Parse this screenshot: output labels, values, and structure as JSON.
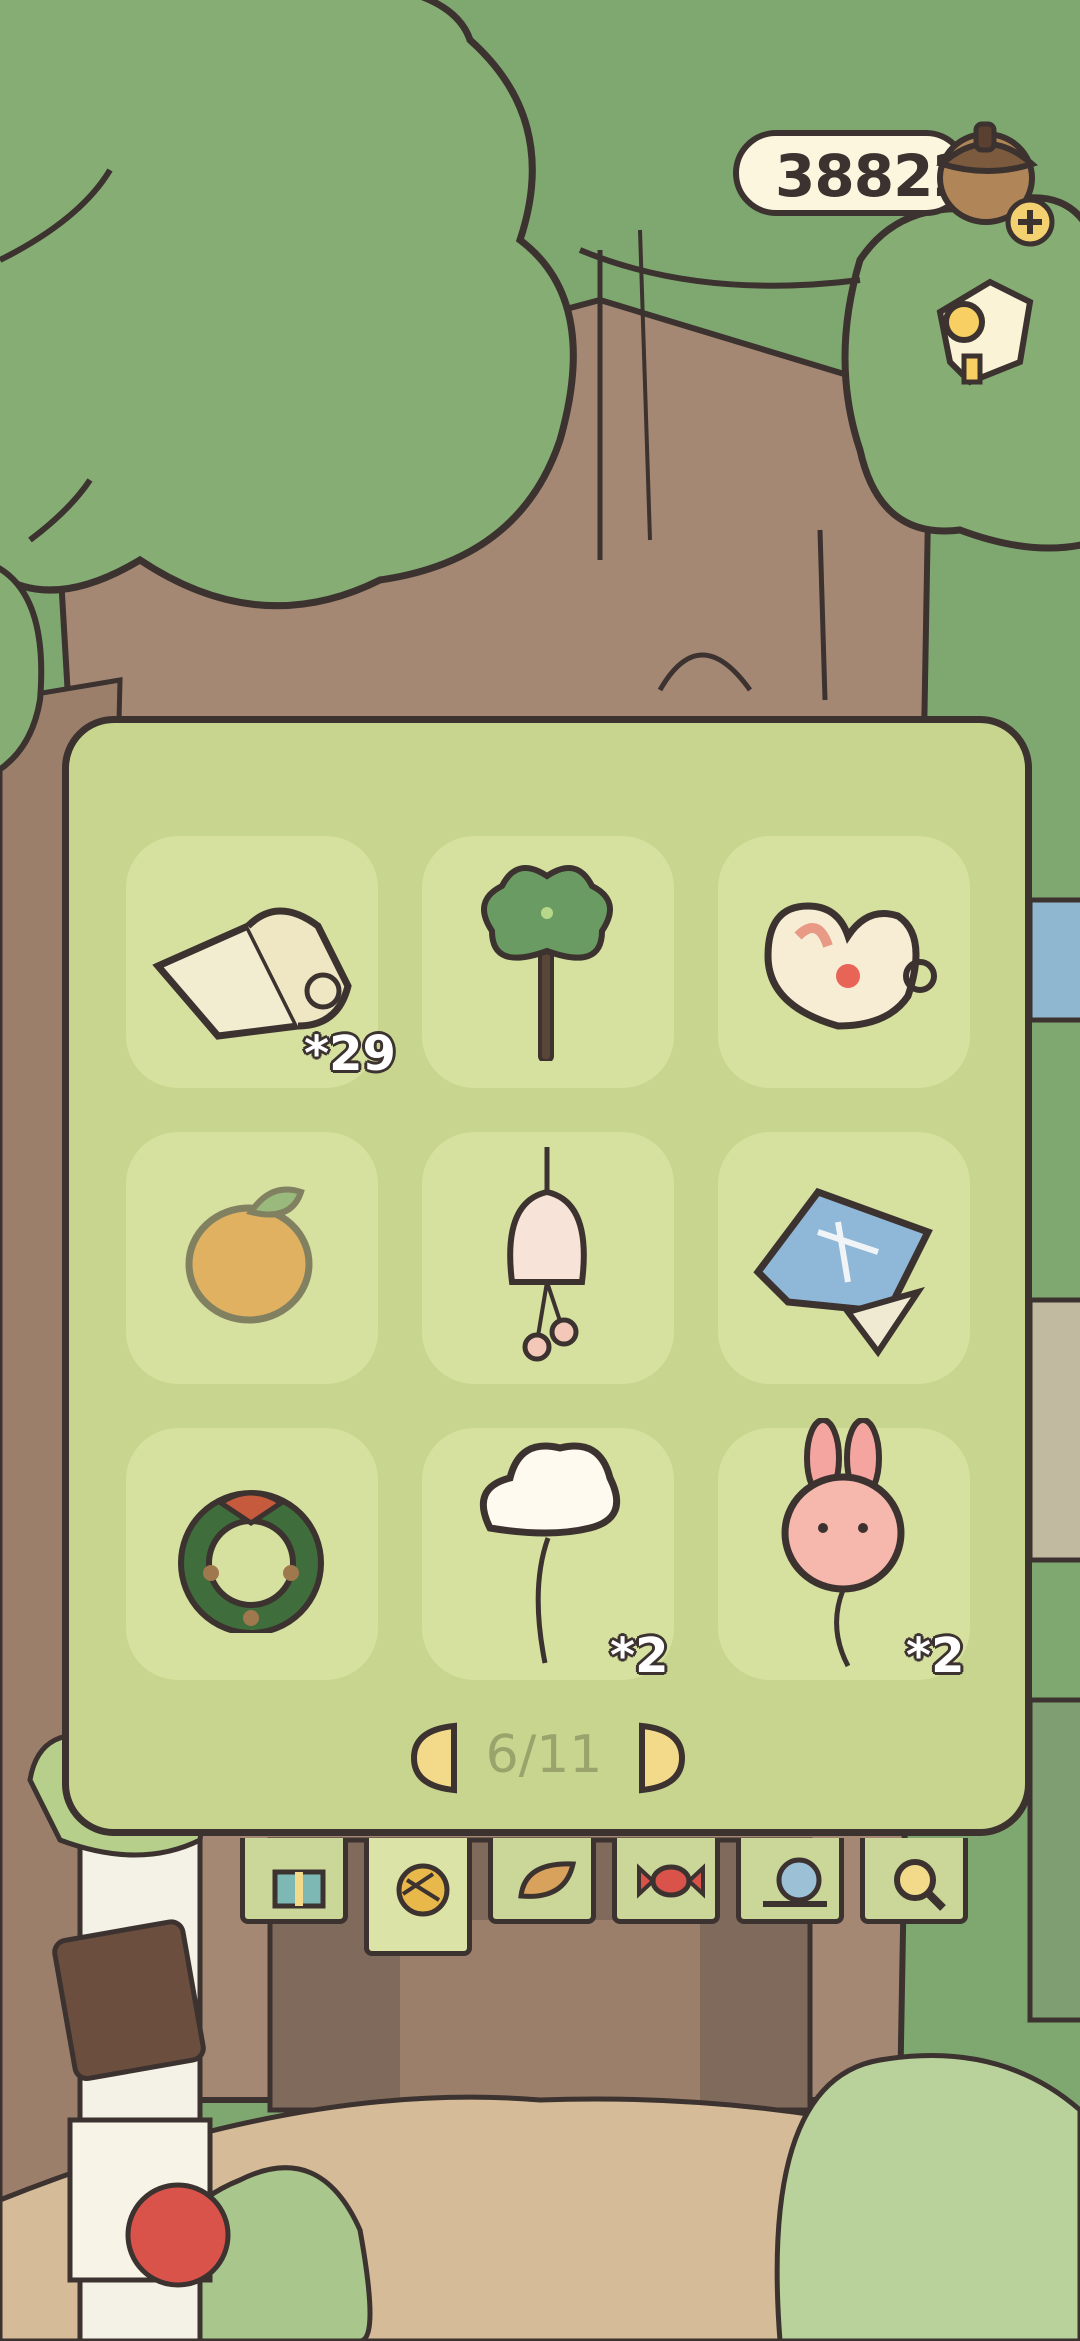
{
  "header": {
    "currency_value": "38822",
    "currency_icon": "acorn-icon",
    "add_icon": "plus-icon",
    "quest_icon": "scroll-icon"
  },
  "panel": {
    "items": [
      {
        "name": "paper-scroll",
        "qty": "*29"
      },
      {
        "name": "clover-stick",
        "qty": ""
      },
      {
        "name": "heart-cup",
        "qty": ""
      },
      {
        "name": "orange-locked",
        "qty": ""
      },
      {
        "name": "wind-chime",
        "qty": ""
      },
      {
        "name": "blueprint-map",
        "qty": ""
      },
      {
        "name": "holiday-wreath",
        "qty": ""
      },
      {
        "name": "cloud-balloon",
        "qty": "*2"
      },
      {
        "name": "bunny-balloon",
        "qty": "*2"
      }
    ],
    "pager": {
      "label": "6/11"
    }
  },
  "tabs": [
    {
      "icon": "gift-icon",
      "active": false
    },
    {
      "icon": "yarn-ball-icon",
      "active": true
    },
    {
      "icon": "leaf-icon",
      "active": false
    },
    {
      "icon": "candy-icon",
      "active": false
    },
    {
      "icon": "snail-icon",
      "active": false
    },
    {
      "icon": "magnifier-icon",
      "active": false
    }
  ],
  "colors": {
    "panel_bg": "#c7d58f",
    "slot_bg": "#d6e19f",
    "outline": "#3c3230",
    "foliage": "#7fa870",
    "trunk": "#a58873"
  }
}
